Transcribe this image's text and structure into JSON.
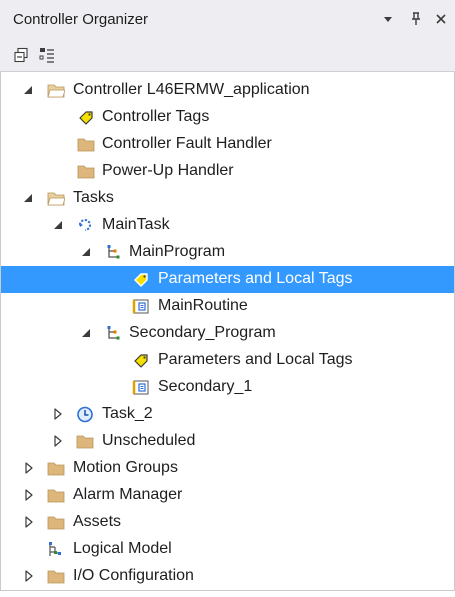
{
  "panel": {
    "title": "Controller Organizer",
    "titlebar_icons": [
      "dropdown-arrow-icon",
      "pin-icon",
      "close-icon"
    ],
    "toolbar_icons": [
      "collapse-all-icon",
      "view-options-icon"
    ]
  },
  "tree": {
    "controller": "Controller L46ERMW_application",
    "controller_tags": "Controller Tags",
    "controller_fault_handler": "Controller Fault Handler",
    "power_up_handler": "Power-Up Handler",
    "tasks": "Tasks",
    "main_task": "MainTask",
    "main_program": "MainProgram",
    "main_program_params": "Parameters and Local Tags",
    "main_routine": "MainRoutine",
    "secondary_program": "Secondary_Program",
    "secondary_params": "Parameters and Local Tags",
    "secondary_1": "Secondary_1",
    "task_2": "Task_2",
    "unscheduled": "Unscheduled",
    "motion_groups": "Motion Groups",
    "alarm_manager": "Alarm Manager",
    "assets": "Assets",
    "logical_model": "Logical Model",
    "io_configuration": "I/O Configuration"
  },
  "colors": {
    "selection": "#3399ff",
    "folder": "#dcb67a",
    "tag_yellow": "#f5e000",
    "task_blue": "#2e6fd6"
  }
}
